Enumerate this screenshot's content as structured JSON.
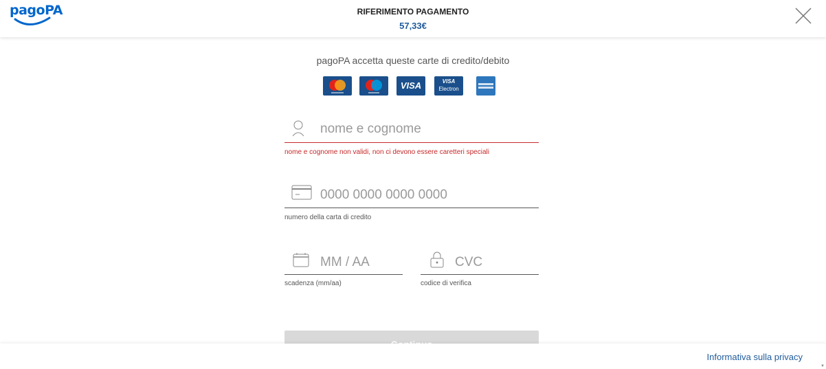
{
  "header": {
    "logo_text": "pagoPA",
    "title": "RIFERIMENTO PAGAMENTO",
    "amount": "57,33€",
    "close_icon": "close-icon"
  },
  "cards_section": {
    "intro": "pagoPA accetta queste carte di credito/debito",
    "cards": [
      {
        "name": "Mastercard",
        "icon": "mastercard-icon",
        "color": "#1a4f8b"
      },
      {
        "name": "Maestro",
        "icon": "maestro-icon",
        "color": "#1a4f8b"
      },
      {
        "name": "VISA",
        "icon": "visa-icon",
        "color": "#1a4f8b"
      },
      {
        "name": "VISA Electron",
        "icon": "visa-electron-icon",
        "color": "#1a4f8b"
      },
      {
        "name": "American Express",
        "icon": "amex-icon",
        "color": "#2e77bc"
      }
    ],
    "visa_text": "VISA",
    "electron_text_1": "VISA",
    "electron_text_2": "Electron"
  },
  "form": {
    "name": {
      "placeholder": "nome e cognome",
      "value": "",
      "error": "nome e cognome non validi, non ci devono essere caretteri speciali",
      "icon": "user-icon"
    },
    "card_number": {
      "placeholder": "0000 0000 0000 0000",
      "value": "",
      "helper": "numero della carta di credito",
      "icon": "credit-card-icon"
    },
    "expiry": {
      "placeholder": "MM / AA",
      "value": "",
      "helper": "scadenza (mm/aa)",
      "icon": "calendar-icon"
    },
    "cvc": {
      "placeholder": "CVC",
      "value": "",
      "helper": "codice di verifica",
      "icon": "lock-icon"
    },
    "continue_label": "Continua"
  },
  "footer": {
    "privacy_link": "Informativa sulla privacy"
  },
  "colors": {
    "brand_blue": "#0066cc",
    "amount_blue": "#1f5b9c",
    "error_red": "#c62828",
    "disabled_button": "#d9d9d9"
  }
}
